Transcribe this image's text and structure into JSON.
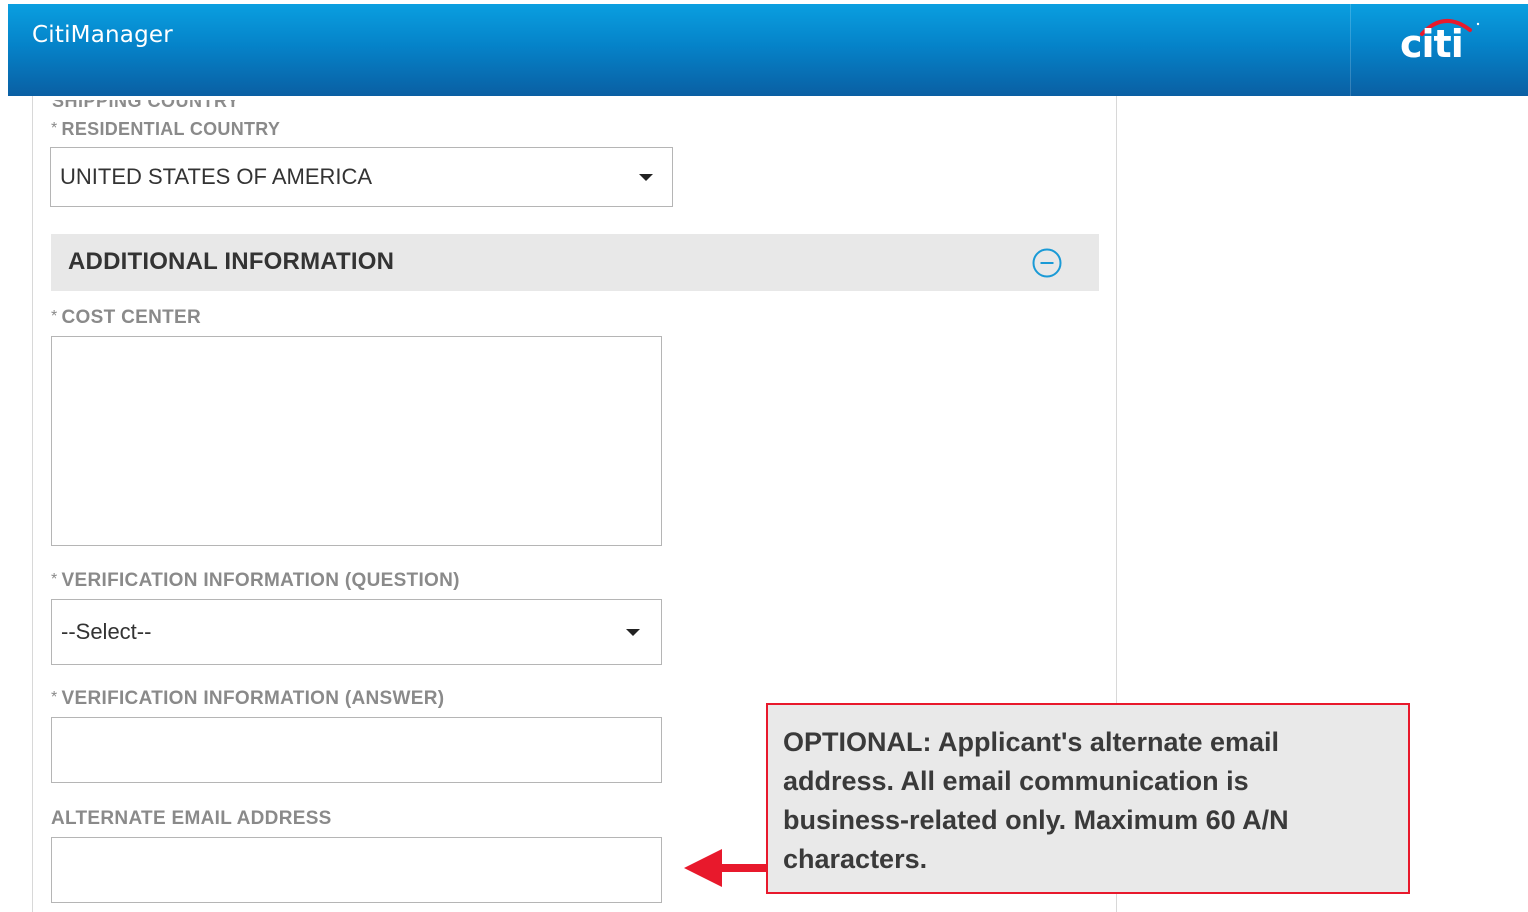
{
  "header": {
    "app_title": "CitiManager",
    "logo_text": "citi"
  },
  "form": {
    "cut_label": "SHIPPING COUNTRY",
    "residential_country": {
      "label": "RESIDENTIAL COUNTRY",
      "value": "UNITED STATES OF AMERICA"
    },
    "section": {
      "title": "ADDITIONAL INFORMATION",
      "toggle_icon": "minus-circle-icon"
    },
    "cost_center": {
      "label": "COST CENTER",
      "value": ""
    },
    "verification_question": {
      "label": "VERIFICATION INFORMATION (QUESTION)",
      "value": "--Select--"
    },
    "verification_answer": {
      "label": "VERIFICATION INFORMATION (ANSWER)",
      "value": ""
    },
    "alternate_email": {
      "label": "ALTERNATE EMAIL ADDRESS",
      "value": ""
    },
    "required_marker": "*"
  },
  "callout": {
    "text": "OPTIONAL: Applicant's alternate email address. All email communication is business-related only. Maximum 60 A/N characters."
  },
  "colors": {
    "header_top": "#0a9fe0",
    "header_bottom": "#0a5fa3",
    "callout_border": "#e8192c",
    "arrow": "#e8192c",
    "toggle_icon": "#1a9ad6"
  }
}
